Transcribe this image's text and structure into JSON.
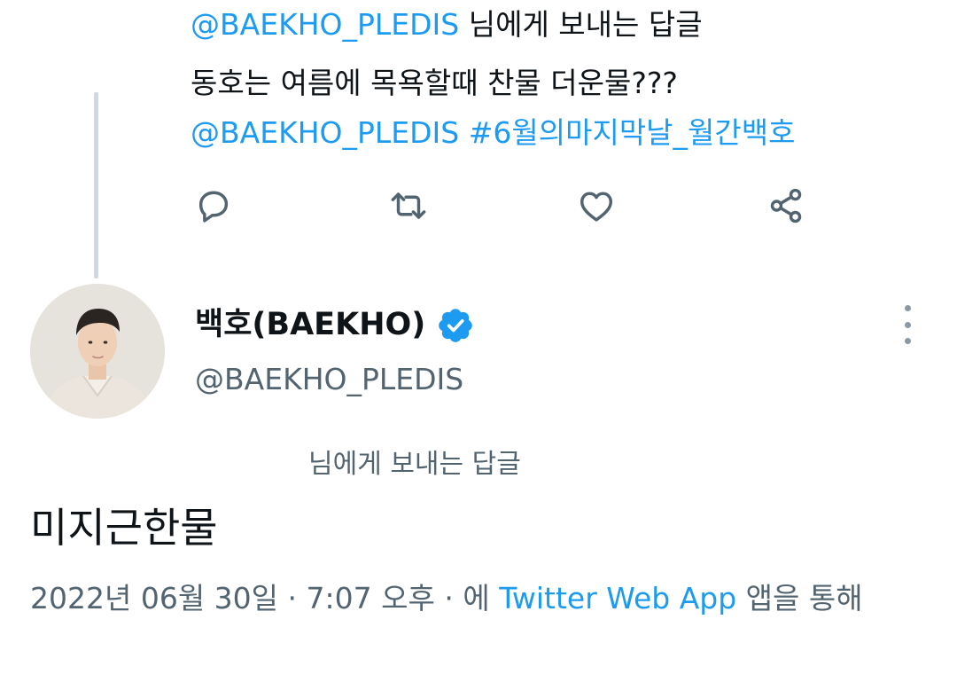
{
  "parent_tweet": {
    "line1": {
      "mention": "@BAEKHO_PLEDIS",
      "suffix": " 님에게 보내는 답글"
    },
    "line2": "동호는 여름에 목욕할때 찬물 더운물???",
    "line3": {
      "mention": "@BAEKHO_PLEDIS",
      "hashtag": "#6월의마지막날_월간백호"
    },
    "actions": [
      {
        "name": "reply",
        "icon": "reply-icon"
      },
      {
        "name": "retweet",
        "icon": "retweet-icon"
      },
      {
        "name": "like",
        "icon": "heart-icon"
      },
      {
        "name": "share",
        "icon": "share-icon"
      }
    ]
  },
  "main_tweet": {
    "author": {
      "name": "백호(BAEKHO)",
      "handle": "@BAEKHO_PLEDIS",
      "verified": true,
      "avatar_icon": "avatar"
    },
    "reply_to": "님에게 보내는 답글",
    "text": "미지근한물",
    "meta": {
      "date": "2022년 06월 30일",
      "sep1": " · ",
      "time": "7:07 오후",
      "sep2": " · ",
      "via_prefix": "에 ",
      "app": "Twitter Web App",
      "via_suffix": " 앱을 통해"
    }
  },
  "colors": {
    "link": "#1d9bf0",
    "text": "#0f1419",
    "secondary": "#536471",
    "verified": "#1d9bf0",
    "thread_line": "#cfd9de"
  }
}
